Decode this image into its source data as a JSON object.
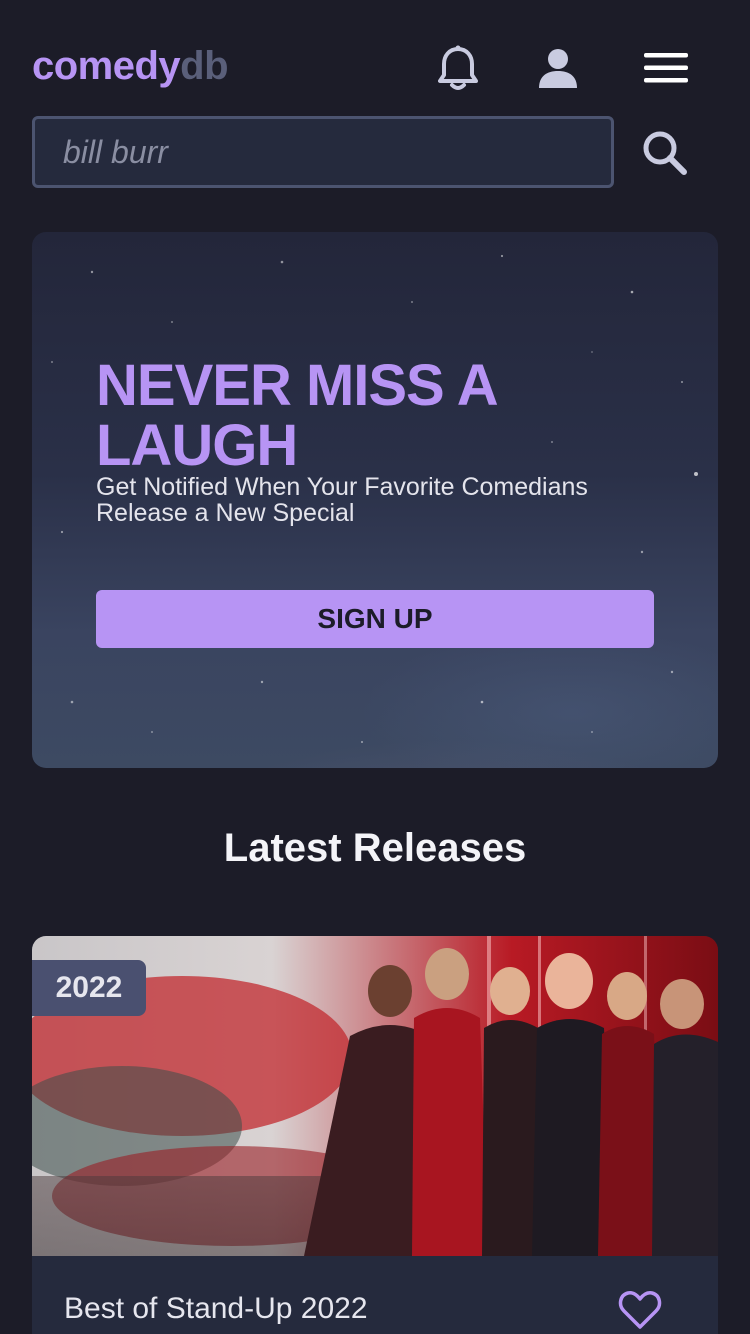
{
  "header": {
    "logo_part1": "comedy",
    "logo_part2": "db",
    "icons": [
      "bell-icon",
      "user-icon",
      "menu-icon"
    ]
  },
  "search": {
    "placeholder": "bill burr",
    "value": ""
  },
  "hero": {
    "title": "NEVER MISS A LAUGH",
    "subtitle": "Get Notified When Your Favorite Comedians Release a New Special",
    "cta_label": "SIGN UP"
  },
  "releases": {
    "heading": "Latest Releases",
    "items": [
      {
        "year": "2022",
        "title": "Best of Stand-Up 2022"
      }
    ]
  },
  "colors": {
    "background": "#1c1c28",
    "accent": "#b794f4",
    "muted": "#5a5f7a",
    "panel": "#252a3d",
    "badge": "#4a5070"
  }
}
